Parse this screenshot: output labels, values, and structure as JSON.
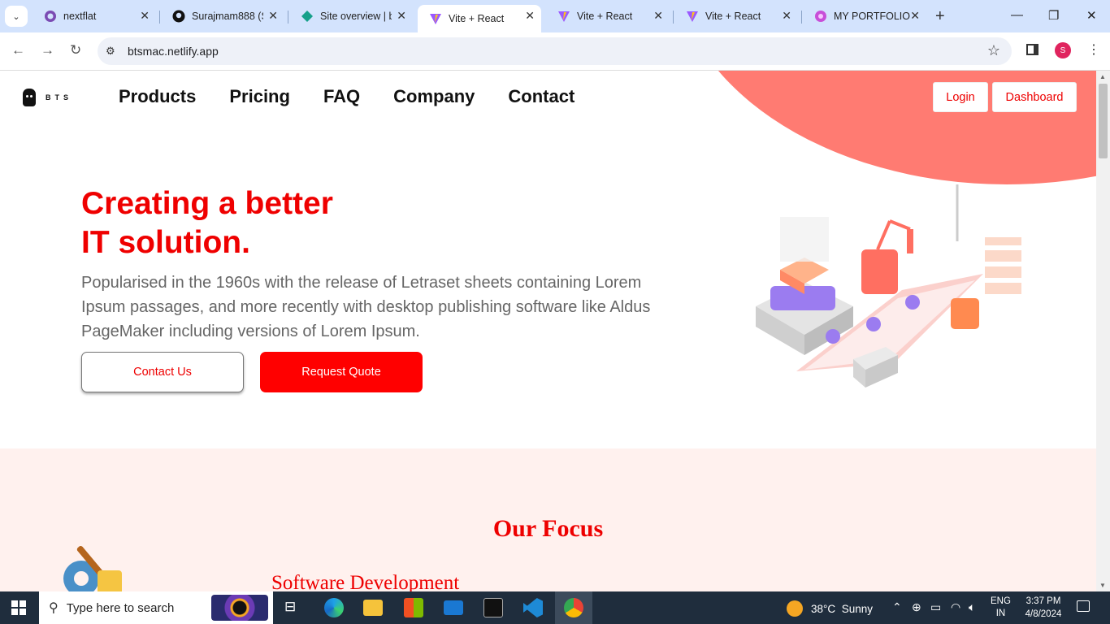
{
  "browser": {
    "tabs": [
      {
        "title": "nextflat",
        "icon": "nextflat-favicon-icon"
      },
      {
        "title": "Surajmam888 (S",
        "icon": "github-icon"
      },
      {
        "title": "Site overview | b",
        "icon": "netlify-icon"
      },
      {
        "title": "Vite + React",
        "icon": "vite-icon",
        "active": true
      },
      {
        "title": "Vite + React",
        "icon": "vite-icon"
      },
      {
        "title": "Vite + React",
        "icon": "vite-icon"
      },
      {
        "title": "MY PORTFOLIO",
        "icon": "portfolio-favicon-icon"
      }
    ],
    "url": "btsmac.netlify.app",
    "profile_initial": "S"
  },
  "site": {
    "logo_text": "BTS",
    "nav": [
      "Products",
      "Pricing",
      "FAQ",
      "Company",
      "Contact"
    ],
    "login_label": "Login",
    "dashboard_label": "Dashboard",
    "hero_title_line1": "Creating a better",
    "hero_title_line2": "IT solution.",
    "hero_text": "Popularised in the 1960s with the release of Letraset sheets containing Lorem Ipsum passages, and more recently with desktop publishing software like Aldus PageMaker including versions of Lorem Ipsum.",
    "contact_label": "Contact Us",
    "quote_label": "Request Quote",
    "focus_title": "Our Focus",
    "focus_item": "Software Development",
    "colors": {
      "accent": "#ff0000",
      "blob": "#ff7b72",
      "focus_bg": "#fff1ee"
    }
  },
  "taskbar": {
    "search_placeholder": "Type here to search",
    "weather_temp": "38°C",
    "weather_text": "Sunny",
    "lang_line1": "ENG",
    "lang_line2": "IN",
    "time": "3:37 PM",
    "date": "4/8/2024"
  }
}
